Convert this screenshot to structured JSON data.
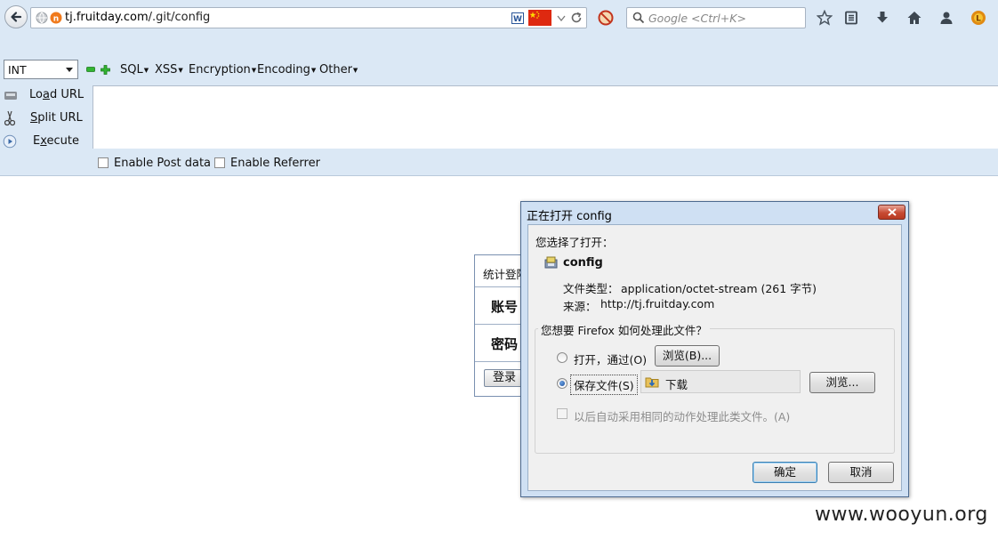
{
  "browser": {
    "url_prefix": "tj.fruitday.com",
    "url_path": "/.git/config",
    "search_placeholder": "Google <Ctrl+K>"
  },
  "hackbar": {
    "select_value": "INT",
    "menus": [
      "SQL",
      "XSS",
      "Encryption",
      "Encoding",
      "Other"
    ],
    "load_url": "Load URL",
    "split_url": "Split URL",
    "execute": "Execute",
    "enable_post": "Enable Post data",
    "enable_referrer": "Enable Referrer"
  },
  "login": {
    "header": "统计登陆",
    "account": "账号",
    "password": "密码",
    "login_button": "登录"
  },
  "dialog": {
    "title": "正在打开 config",
    "chosen_label": "您选择了打开：",
    "file_name": "config",
    "file_type_label": "文件类型：",
    "file_type_value": "application/octet-stream (261 字节)",
    "source_label": "来源：",
    "source_value": "http://tj.fruitday.com",
    "question": "您想要 Firefox 如何处理此文件？",
    "open_with_label": "打开，通过(O)",
    "browse_b": "浏览(B)...",
    "save_file_label": "保存文件(S)",
    "download_folder": "下载",
    "browse": "浏览...",
    "auto_label": "以后自动采用相同的动作处理此类文件。(A)",
    "ok": "确定",
    "cancel": "取消",
    "selected_option": "save"
  },
  "watermark": "www.wooyun.org"
}
